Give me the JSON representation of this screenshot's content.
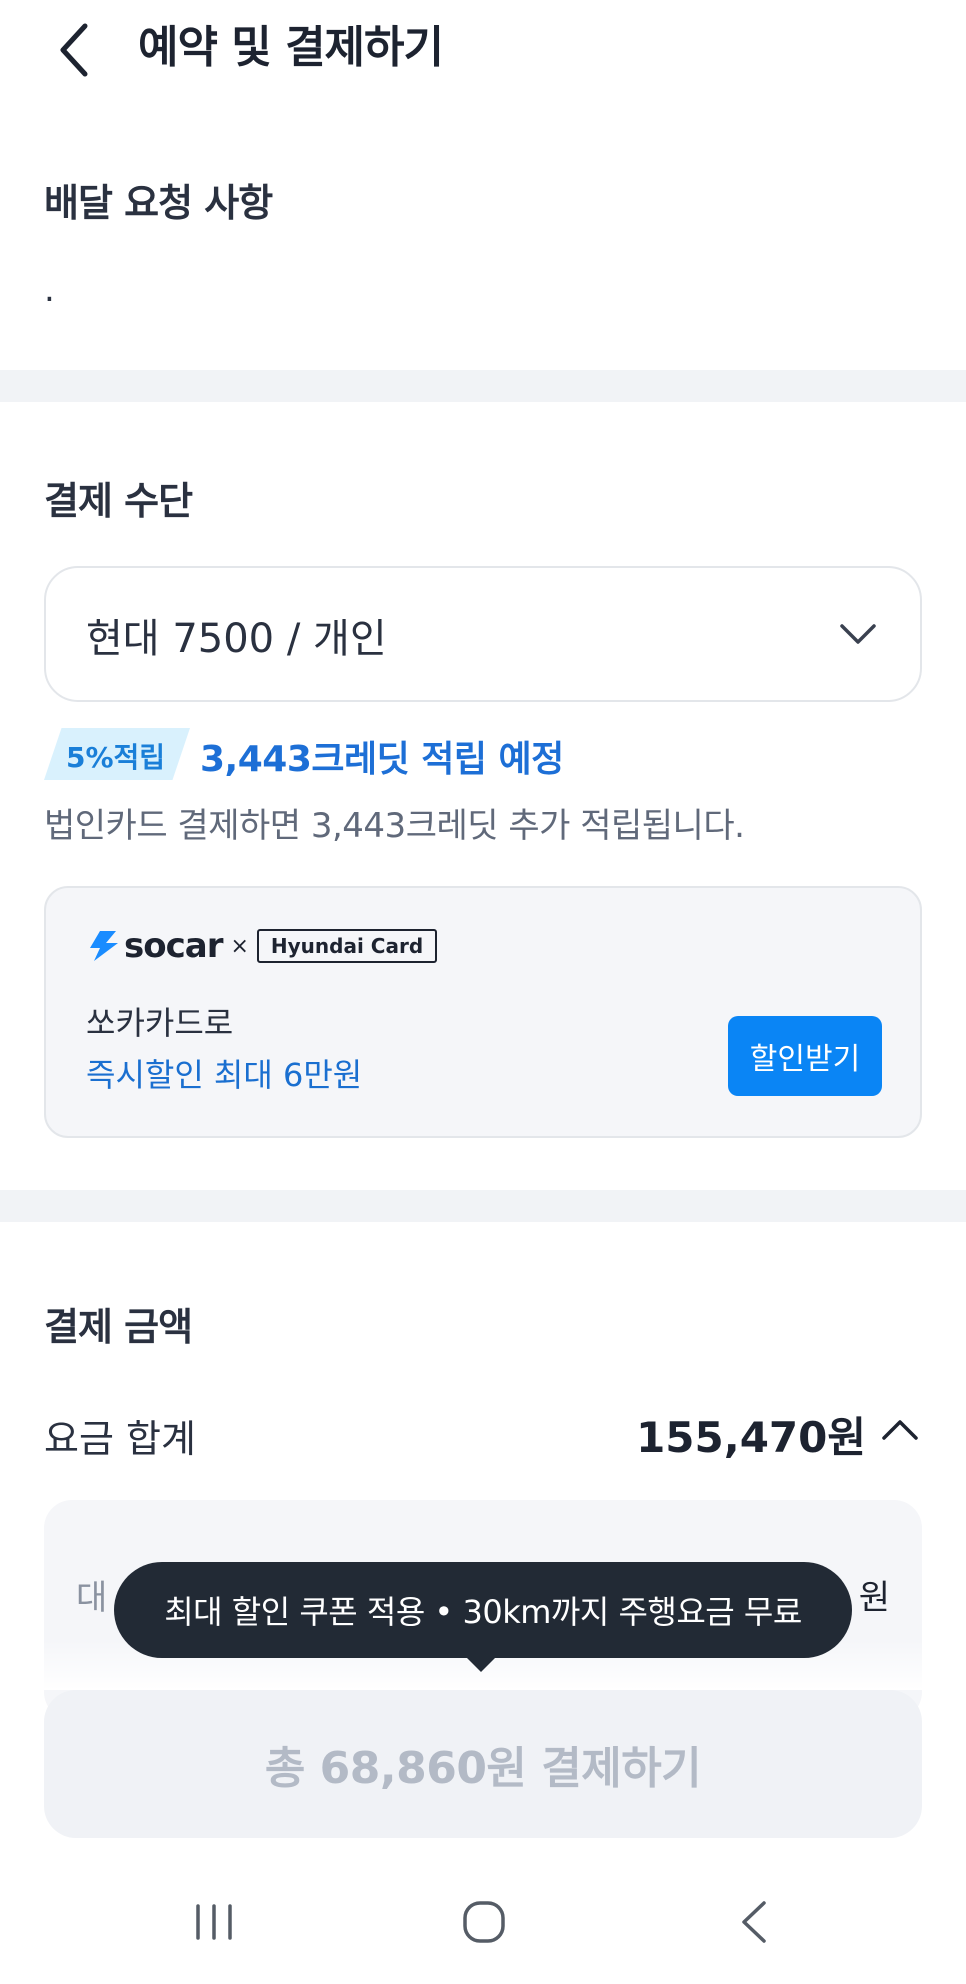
{
  "header": {
    "title": "예약 및 결제하기"
  },
  "delivery": {
    "title": "배달 요청 사항",
    "value": "."
  },
  "payment_method": {
    "title": "결제 수단",
    "selected": "현대 7500 / 개인",
    "credit_badge": "5%적립",
    "credit_text": "3,443크레딧 적립 예정",
    "corp_text": "법인카드 결제하면 3,443크레딧 추가 적립됩니다."
  },
  "promo": {
    "brand": "socar",
    "times": "×",
    "partner": "Hyundai Card",
    "line1": "쏘카카드로",
    "line2": "즉시할인 최대 6만원",
    "button": "할인받기"
  },
  "amount": {
    "title": "결제 금액",
    "fee_label": "요금 합계",
    "fee_value": "155,470원",
    "breakdown_label": "대",
    "breakdown_value": "원"
  },
  "tooltip": {
    "text": "최대 할인 쿠폰 적용 • 30km까지 주행요금 무료"
  },
  "pay_button": {
    "label": "총 68,860원 결제하기"
  },
  "colors": {
    "accent_blue": "#0a85f5",
    "credit_blue": "#1d6fd6",
    "tooltip_bg": "#222a35"
  }
}
